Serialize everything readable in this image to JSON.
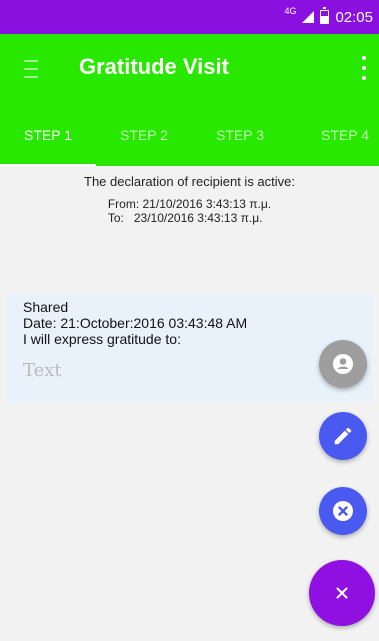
{
  "status_bar": {
    "network": "4G",
    "time": "02:05",
    "icons": [
      "signal-icon",
      "battery-icon"
    ],
    "color": "#8a10e0"
  },
  "app_bar": {
    "title": "Gratitude Visit",
    "color": "#28e800",
    "icons": [
      "menu-icon",
      "more-vertical-icon"
    ]
  },
  "tabs": [
    {
      "label": "STEP 1",
      "active": true
    },
    {
      "label": "STEP 2",
      "active": false
    },
    {
      "label": "STEP 3",
      "active": false
    },
    {
      "label": "STEP 4",
      "active": false
    }
  ],
  "declaration": {
    "title": "The declaration of recipient is active:",
    "from": "From: 21/10/2016 3:43:13 π.μ.",
    "to": "To:   23/10/2016 3:43:13 π.μ."
  },
  "shared": {
    "heading": "Shared",
    "date": "Date: 21:October:2016 03:43:48 AM",
    "prompt": "I will express gratitude to:",
    "input_value": "",
    "input_placeholder": "Text"
  },
  "fabs": [
    {
      "icon": "person-icon",
      "color": "#9e9e9e"
    },
    {
      "icon": "edit-pencil-icon",
      "color": "#4a59ef"
    },
    {
      "icon": "cancel-circle-icon",
      "color": "#4a59ef"
    },
    {
      "icon": "close-icon",
      "color": "#8f10e0"
    }
  ]
}
